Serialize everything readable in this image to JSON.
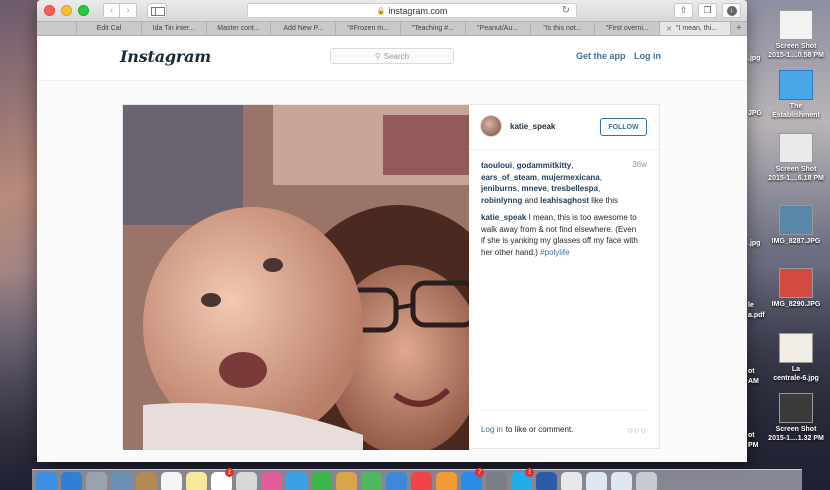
{
  "browser": {
    "url": "instagram.com",
    "tabs": [
      {
        "label": "Edit Cal"
      },
      {
        "label": "Ida Tin inter..."
      },
      {
        "label": "Master cont..."
      },
      {
        "label": "Add New P..."
      },
      {
        "label": "\"#Frozen m..."
      },
      {
        "label": "\"Teaching #..."
      },
      {
        "label": "\"Peanut/Au..."
      },
      {
        "label": "\"Is this not..."
      },
      {
        "label": "\"First overni..."
      },
      {
        "label": "\"I mean, thi..."
      }
    ],
    "new_tab": "+"
  },
  "instagram": {
    "logo": "Instagram",
    "search_placeholder": "Search",
    "get_app": "Get the app",
    "login": "Log in"
  },
  "post": {
    "username": "katie_speak",
    "follow_label": "FOLLOW",
    "time_ago": "36w",
    "likers": [
      "taouloui",
      "godammitkitty",
      "ears_of_steam",
      "mujermexicana",
      "jeniburns",
      "mneve",
      "tresbellespa",
      "robinlynng",
      "leahisaghost"
    ],
    "likes_suffix": "like this",
    "likes_and": "and",
    "caption_user": "katie_speak",
    "caption_text": "I mean, this is too awesome to walk away from & not find elsewhere. (Even if she is yanking my glasses off my face with her other hand.)",
    "caption_tag": "#polylife",
    "footer_login": "Log in",
    "footer_text": "to like or comment.",
    "more": "○○○"
  },
  "desktop": {
    "icons": [
      {
        "label1": "Screen Shot",
        "label2": "2015-1....0.58 PM"
      },
      {
        "label1": "The",
        "label2": "Establishment"
      },
      {
        "label1": "Screen Shot",
        "label2": "2015-1....6.18 PM"
      },
      {
        "label1": "IMG_8287.JPG",
        "label2": ""
      },
      {
        "label1": "IMG_8290.JPG",
        "label2": ""
      },
      {
        "label1": "La",
        "label2": "centrale-6.jpg"
      },
      {
        "label1": "Screen Shot",
        "label2": "2015-1....1.32 PM"
      }
    ],
    "partial_labels": [
      ".jpg",
      "JPG",
      ".jpg",
      "le",
      "a.pdf",
      "ot",
      "AM",
      "ot",
      "PM"
    ]
  },
  "dock": {
    "badges": [
      "1",
      "7",
      "1"
    ]
  },
  "colors": {
    "instagram_blue": "#3f729b",
    "username_navy": "#1f3c5c"
  }
}
